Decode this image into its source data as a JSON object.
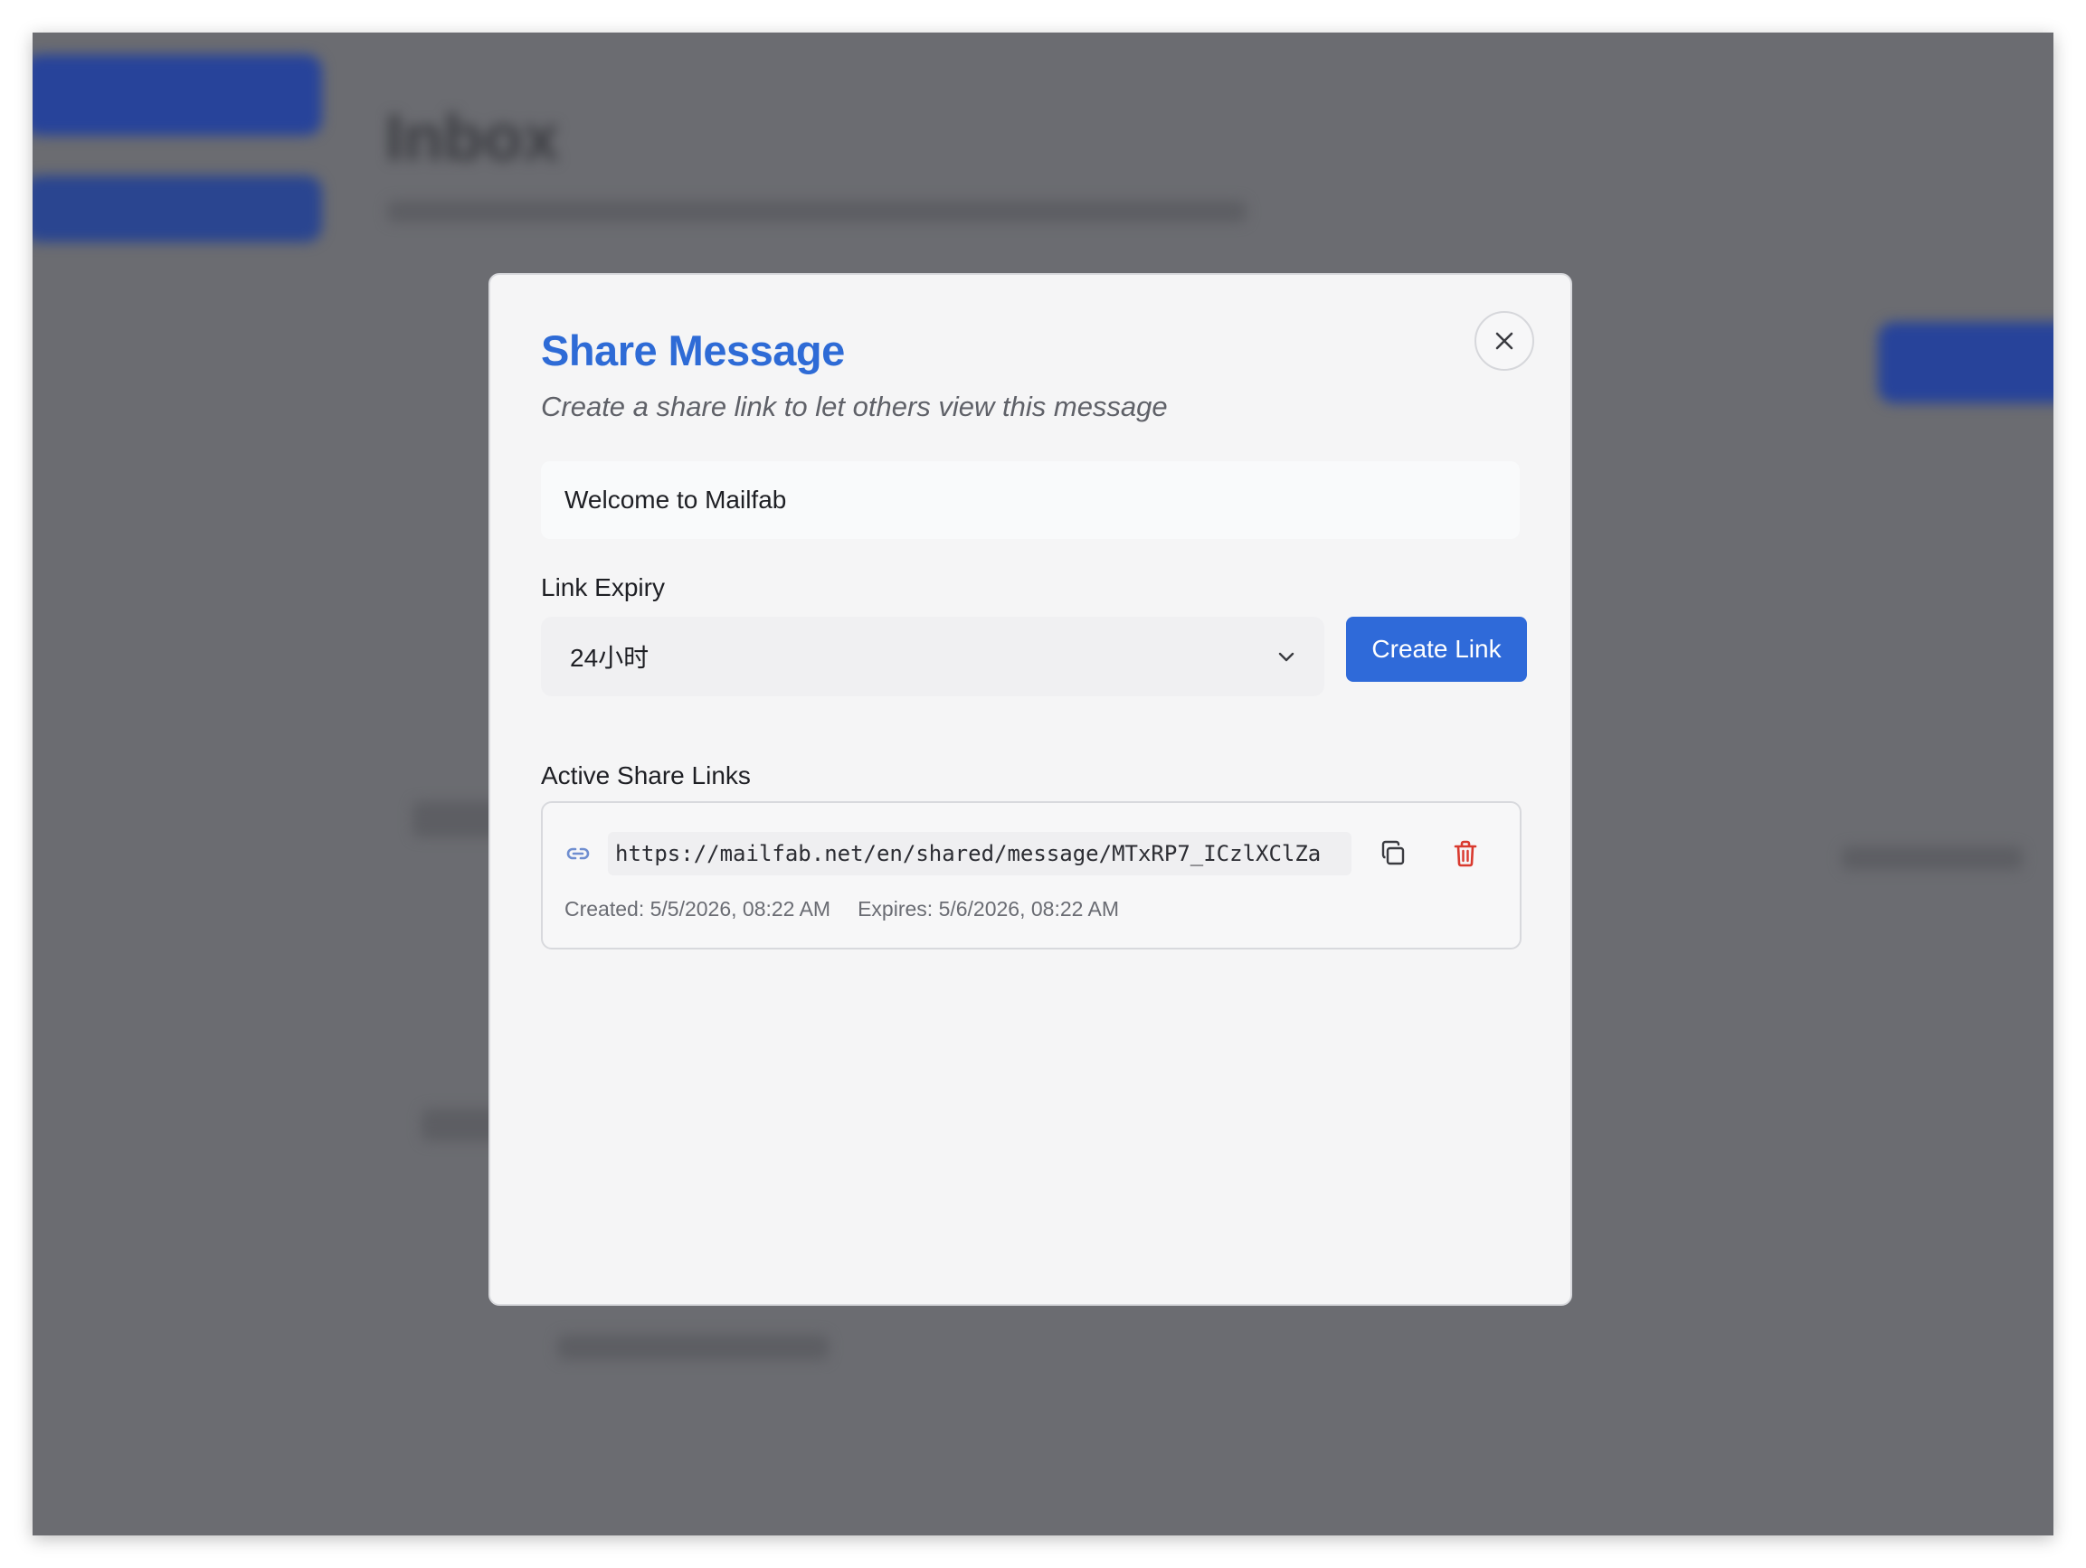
{
  "background": {
    "page_title": "Inbox"
  },
  "modal": {
    "title": "Share Message",
    "subtitle": "Create a share link to let others view this message",
    "subject": "Welcome to Mailfab",
    "expiry_label": "Link Expiry",
    "expiry_selected": "24小时",
    "create_button": "Create Link",
    "active_links_label": "Active Share Links",
    "links": [
      {
        "url": "https://mailfab.net/en/shared/message/MTxRP7_ICzlXClZa",
        "created": "Created: 5/5/2026, 08:22 AM",
        "expires": "Expires: 5/6/2026, 08:22 AM"
      }
    ]
  },
  "colors": {
    "accent": "#2f6ad9",
    "danger": "#d93a2f",
    "overlay": "#6b6c71"
  },
  "icons": {
    "close": "close-icon",
    "chevron": "chevron-down-icon",
    "link": "link-icon",
    "copy": "copy-icon",
    "delete": "trash-icon"
  }
}
